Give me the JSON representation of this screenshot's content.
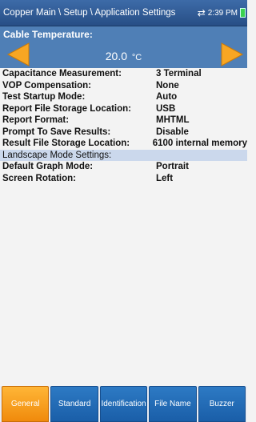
{
  "header": {
    "breadcrumb": "Copper Main \\ Setup \\ Application Settings",
    "time": "2:39 PM",
    "network_icon": "network-arrows-icon",
    "battery_icon": "battery-icon"
  },
  "temperature": {
    "label": "Cable Temperature:",
    "value": "20.0",
    "unit": "°C"
  },
  "settings": [
    {
      "label": "Capacitance Measurement:",
      "value": "3 Terminal"
    },
    {
      "label": "VOP Compensation:",
      "value": "None"
    },
    {
      "label": "Test Startup Mode:",
      "value": "Auto"
    },
    {
      "label": "Report File Storage Location:",
      "value": "USB"
    },
    {
      "label": "Report Format:",
      "value": "MHTML"
    },
    {
      "label": "Prompt To Save Results:",
      "value": "Disable"
    },
    {
      "label": "Result File Storage Location:",
      "value": "6100 internal memory"
    }
  ],
  "landscape": {
    "section_label": "Landscape Mode Settings:",
    "items": [
      {
        "label": "Default Graph Mode:",
        "value": "Portrait"
      },
      {
        "label": "Screen Rotation:",
        "value": "Left"
      }
    ]
  },
  "tabs": [
    {
      "label": "General",
      "active": true
    },
    {
      "label": "Standard",
      "active": false
    },
    {
      "label": "Identification",
      "active": false
    },
    {
      "label": "File Name",
      "active": false
    },
    {
      "label": "Buzzer",
      "active": false
    }
  ],
  "colors": {
    "accent_orange": "#f08a0c",
    "header_blue": "#274e85",
    "panel_blue": "#4f7fb6",
    "tab_blue": "#1a5ea8"
  }
}
